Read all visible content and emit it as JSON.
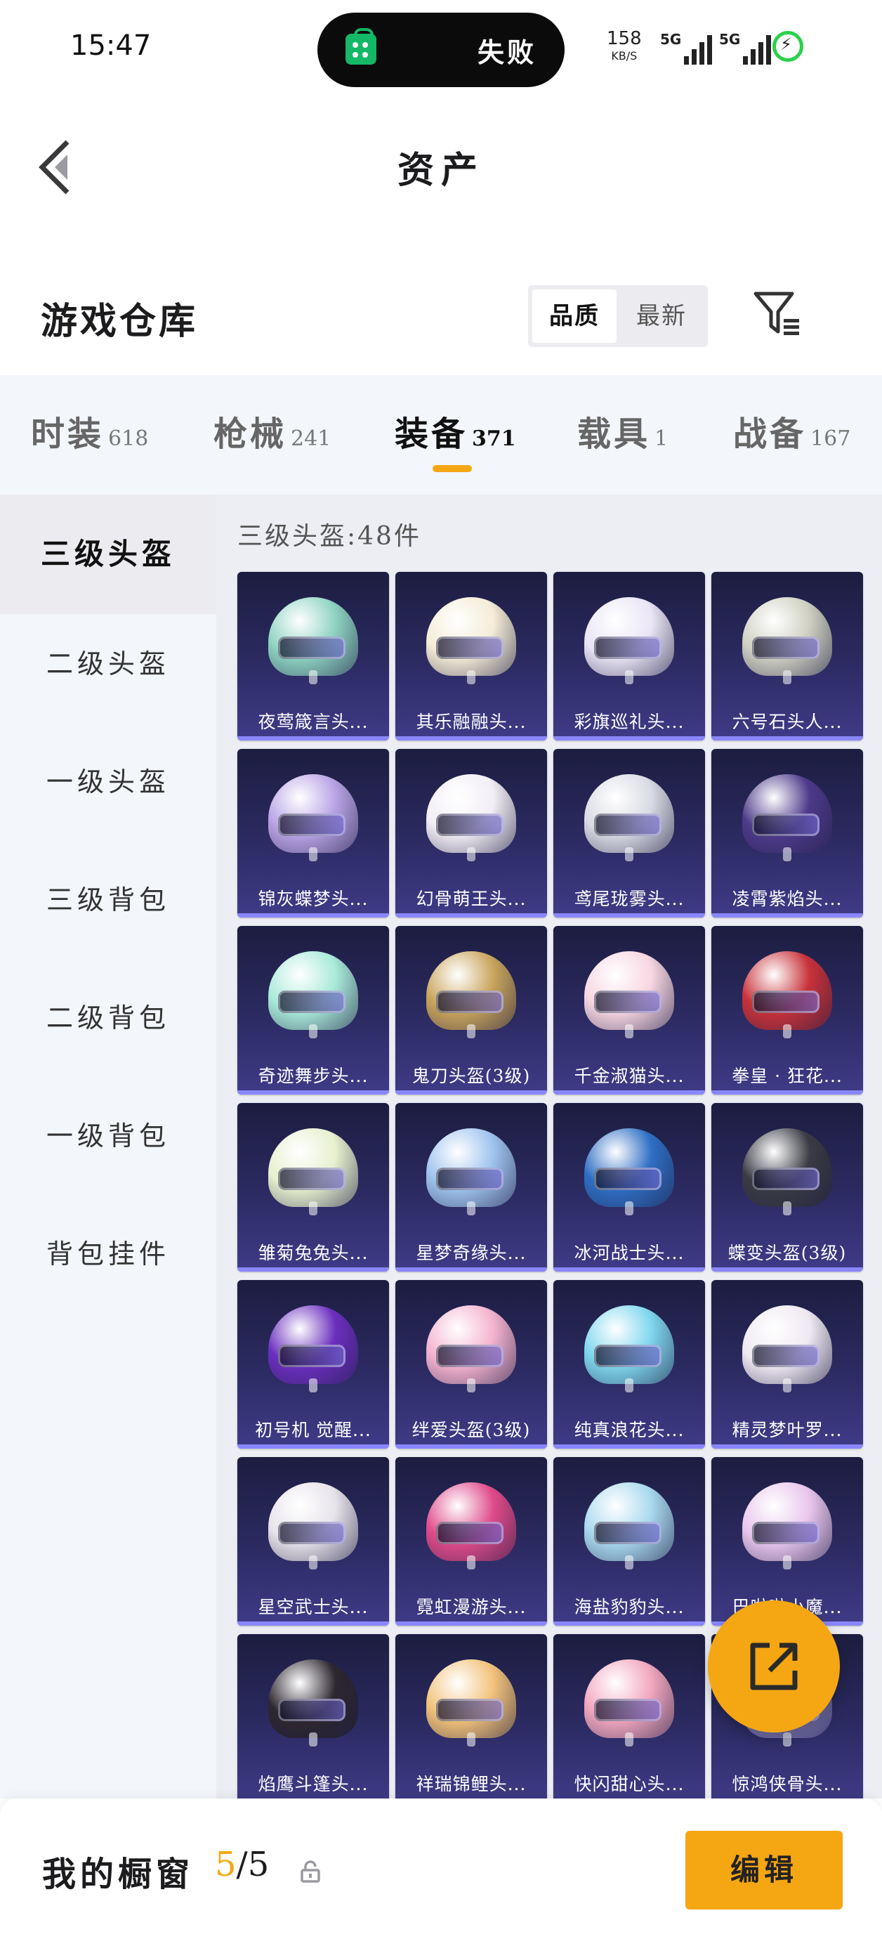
{
  "status_bar": {
    "time": "15:47",
    "notification_text": "失败",
    "net_speed_value": "158",
    "net_speed_unit": "KB/S",
    "signal_1_label": "5G",
    "signal_2_label": "5G"
  },
  "nav": {
    "title": "资产"
  },
  "section": {
    "title": "游戏仓库",
    "sort_options": [
      "品质",
      "最新"
    ],
    "sort_active": "品质"
  },
  "tabs": [
    {
      "name": "时装",
      "count": "618"
    },
    {
      "name": "枪械",
      "count": "241"
    },
    {
      "name": "装备",
      "count": "371"
    },
    {
      "name": "载具",
      "count": "1"
    },
    {
      "name": "战备",
      "count": "167"
    }
  ],
  "active_tab": "装备",
  "sidebar": {
    "items": [
      "三级头盔",
      "二级头盔",
      "一级头盔",
      "三级背包",
      "二级背包",
      "一级背包",
      "背包挂件"
    ],
    "active": "三级头盔"
  },
  "content": {
    "header": "三级头盔:48件",
    "items": [
      {
        "label": "夜莺箴言头...",
        "color": "#8ed3c2"
      },
      {
        "label": "其乐融融头...",
        "color": "#f4ecd6"
      },
      {
        "label": "彩旗巡礼头...",
        "color": "#e9e5f5"
      },
      {
        "label": "六号石头人...",
        "color": "#cfd0c2"
      },
      {
        "label": "锦灰蝶梦头...",
        "color": "#b9a4e6"
      },
      {
        "label": "幻骨萌王头...",
        "color": "#f2eef5"
      },
      {
        "label": "鸢尾珑雾头...",
        "color": "#d9dbe4"
      },
      {
        "label": "凌霄紫焰头...",
        "color": "#4d3a8a"
      },
      {
        "label": "奇迹舞步头...",
        "color": "#a9ead9"
      },
      {
        "label": "鬼刀头盔(3级)",
        "color": "#c9a55c"
      },
      {
        "label": "千金淑猫头...",
        "color": "#f7d6e2"
      },
      {
        "label": "拳皇 · 狂花...",
        "color": "#c8323a"
      },
      {
        "label": "雏菊兔兔头...",
        "color": "#e7f0cf"
      },
      {
        "label": "星梦奇缘头...",
        "color": "#9fc3ee"
      },
      {
        "label": "冰河战士头...",
        "color": "#2f6fc4"
      },
      {
        "label": "蝶变头盔(3级)",
        "color": "#3a3b44"
      },
      {
        "label": "初号机 觉醒...",
        "color": "#6b2fbf"
      },
      {
        "label": "绊爱头盔(3级)",
        "color": "#f4b3cf"
      },
      {
        "label": "纯真浪花头...",
        "color": "#7fd7ee"
      },
      {
        "label": "精灵梦叶罗...",
        "color": "#efe9f2"
      },
      {
        "label": "星空武士头...",
        "color": "#e7e3ea"
      },
      {
        "label": "霓虹漫游头...",
        "color": "#e04b8a"
      },
      {
        "label": "海盐豹豹头...",
        "color": "#a9d9ef"
      },
      {
        "label": "巴啦啦小魔...",
        "color": "#e9c6ee"
      },
      {
        "label": "焰鹰斗篷头...",
        "color": "#2d2730"
      },
      {
        "label": "祥瑞锦鲤头...",
        "color": "#f2c27a"
      },
      {
        "label": "快闪甜心头...",
        "color": "#f2a7bf"
      },
      {
        "label": "惊鸿侠骨头...",
        "color": "#8d87c9"
      }
    ]
  },
  "bottom": {
    "showcase_label": "我的橱窗",
    "showcase_used": "5",
    "showcase_sep": "/",
    "showcase_total": "5",
    "edit_label": "编辑"
  }
}
